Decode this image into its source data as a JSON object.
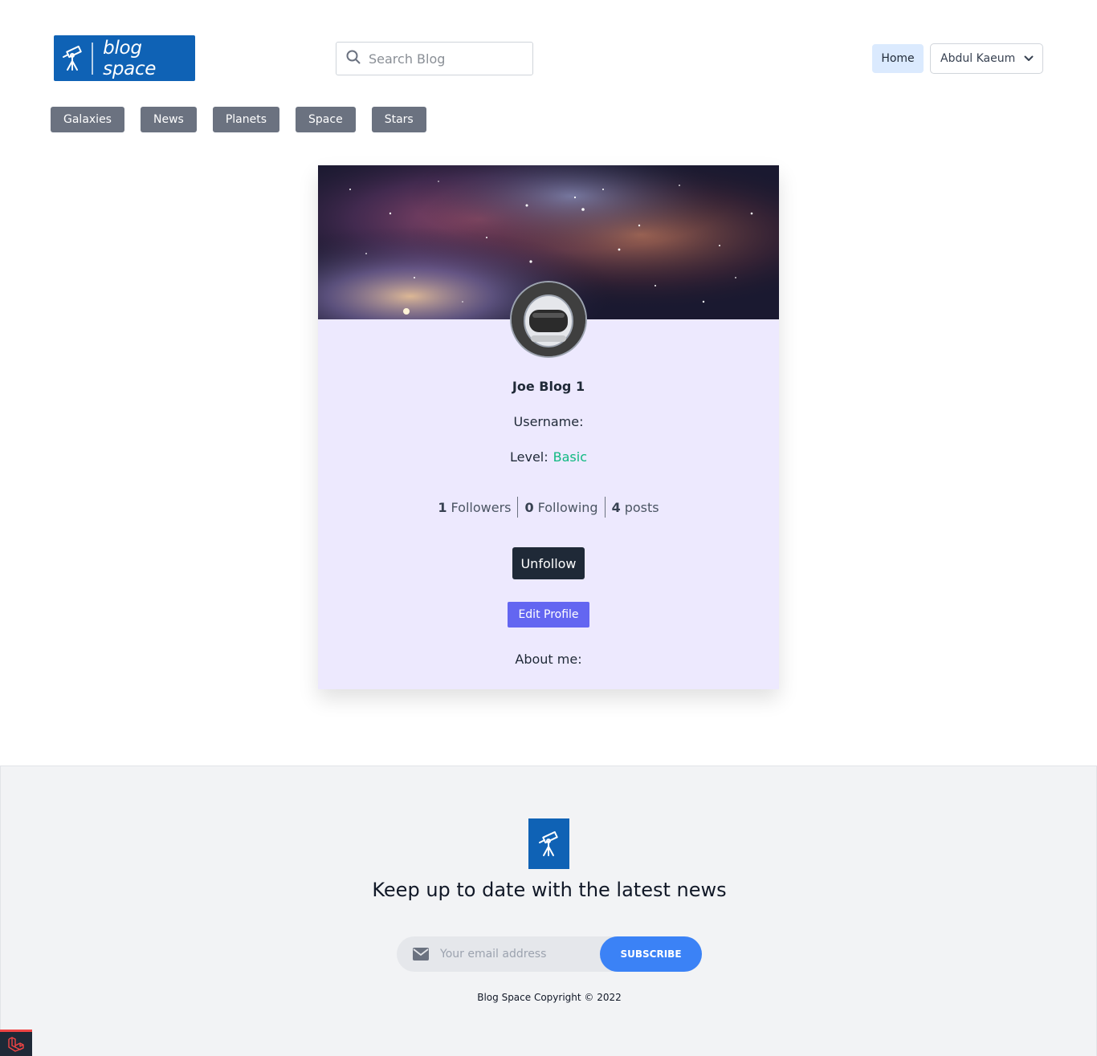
{
  "header": {
    "logo_text": "blog space",
    "search_placeholder": "Search Blog",
    "home_label": "Home",
    "user_name": "Abdul Kaeum"
  },
  "categories": [
    "Galaxies",
    "News",
    "Planets",
    "Space",
    "Stars"
  ],
  "profile": {
    "name": "Joe Blog 1",
    "username_label": "Username:",
    "level_label": "Level:",
    "level_value": "Basic",
    "followers_count": "1",
    "followers_label": "Followers",
    "following_count": "0",
    "following_label": "Following",
    "posts_count": "4",
    "posts_label": "posts",
    "unfollow_label": "Unfollow",
    "edit_label": "Edit Profile",
    "about_label": "About me:"
  },
  "footer": {
    "heading": "Keep up to date with the latest news",
    "email_placeholder": "Your email address",
    "subscribe_label": "SUBSCRIBE",
    "copyright": "Blog Space Copyright © 2022"
  },
  "colors": {
    "brand": "#0f62b5",
    "card_bg": "#ede9fe",
    "level": "#10b981",
    "edit_button": "#6366f1",
    "subscribe_button": "#3b82f6"
  },
  "icons": {
    "logo": "telescope-icon",
    "search": "search-icon",
    "dropdown": "chevron-down-icon",
    "email": "mail-icon",
    "debug": "laravel-icon"
  }
}
